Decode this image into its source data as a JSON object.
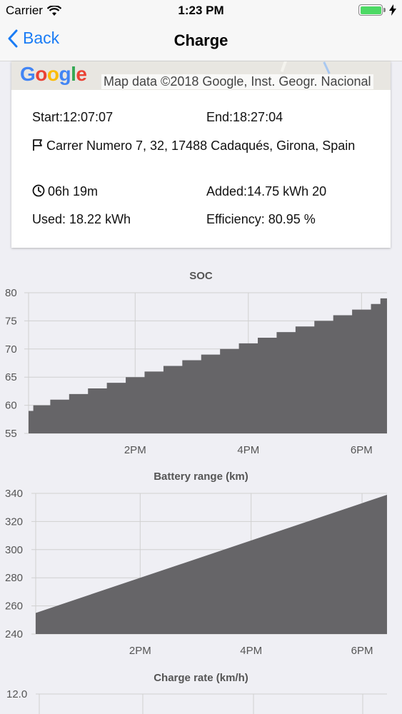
{
  "status": {
    "carrier": "Carrier",
    "time": "1:23 PM",
    "battery_level": 1.0
  },
  "nav": {
    "back_label": "Back",
    "title": "Charge"
  },
  "map": {
    "logo": [
      "G",
      "o",
      "o",
      "g",
      "l",
      "e"
    ],
    "attribution": "Map data ©2018 Google, Inst. Geogr. Nacional"
  },
  "details": {
    "start": "Start:12:07:07",
    "end": "End:18:27:04",
    "address": "Carrer Numero 7, 32, 17488 Cadaqués, Girona, Spain",
    "duration": "06h 19m",
    "added": "Added:14.75 kWh 20",
    "used": "Used: 18.22 kWh",
    "efficiency": "Efficiency: 80.95 %"
  },
  "chart_data": [
    {
      "type": "area",
      "title": "SOC",
      "x_range": [
        "12:07",
        "18:27"
      ],
      "x_ticks": [
        "2PM",
        "4PM",
        "6PM"
      ],
      "ylim": [
        55,
        80
      ],
      "y_ticks": [
        "80",
        "75",
        "70",
        "65",
        "60",
        "55"
      ],
      "grid": true,
      "series": [
        {
          "x": [
            "12:07",
            "12:12",
            "12:30",
            "12:50",
            "13:10",
            "13:30",
            "13:50",
            "14:10",
            "14:30",
            "14:50",
            "15:10",
            "15:30",
            "15:50",
            "16:10",
            "16:30",
            "16:50",
            "17:10",
            "17:30",
            "17:50",
            "18:10",
            "18:20",
            "18:27"
          ],
          "values": [
            59,
            60,
            61,
            62,
            63,
            64,
            65,
            66,
            67,
            68,
            69,
            70,
            71,
            72,
            73,
            74,
            75,
            76,
            77,
            78,
            79,
            79
          ]
        }
      ]
    },
    {
      "type": "area",
      "title": "Battery range (km)",
      "x_range": [
        "12:07",
        "18:27"
      ],
      "x_ticks": [
        "2PM",
        "4PM",
        "6PM"
      ],
      "ylim": [
        240,
        340
      ],
      "y_ticks": [
        "340",
        "320",
        "300",
        "280",
        "260",
        "240"
      ],
      "grid": true,
      "series": [
        {
          "x": [
            "12:07",
            "18:27"
          ],
          "values": [
            255,
            339
          ]
        }
      ]
    },
    {
      "type": "area",
      "title": "Charge rate (km/h)",
      "y_ticks": [
        "12.0"
      ],
      "grid": true,
      "series": []
    }
  ]
}
